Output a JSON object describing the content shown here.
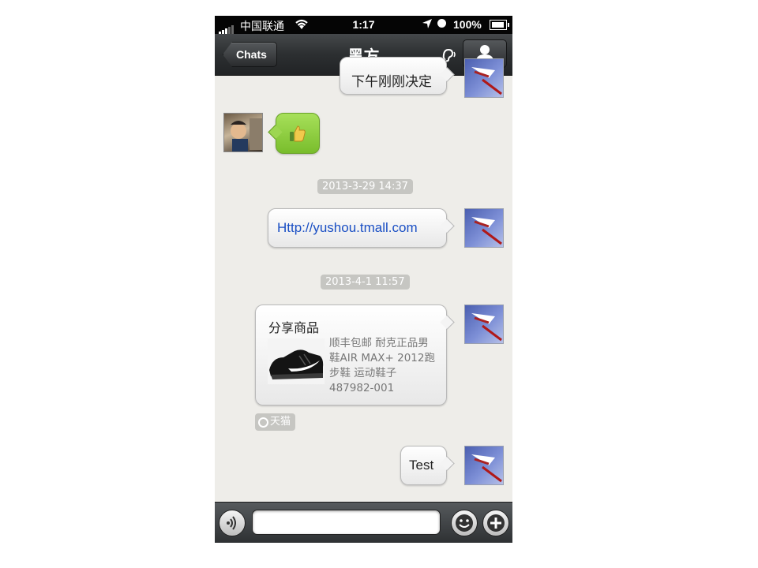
{
  "status_bar": {
    "carrier": "中国联通",
    "time": "1:17",
    "battery": "100%"
  },
  "nav": {
    "back_label": "Chats",
    "title": "黑方"
  },
  "messages": {
    "partial_text": "下午刚刚决定",
    "timestamp_1": "2013-3-29 14:37",
    "link_text": "Http://yushou.tmall.com",
    "timestamp_2": "2013-4-1 11:57",
    "share_title": "分享商品",
    "share_desc": "顺丰包邮 耐克正品男鞋AIR MAX+ 2012跑步鞋 运动鞋子 487982-001",
    "share_source": "天猫",
    "test_text": "Test"
  },
  "input": {
    "placeholder": ""
  },
  "colors": {
    "link": "#1a4fc4",
    "thumbs_bubble": "#8ccf3f"
  },
  "icons": [
    "signal-icon",
    "wifi-icon",
    "location-icon",
    "clock-icon",
    "battery-icon",
    "ear-icon",
    "person-icon",
    "thumbs-up-icon",
    "voice-icon",
    "emoji-icon",
    "plus-icon",
    "tmall-icon"
  ]
}
